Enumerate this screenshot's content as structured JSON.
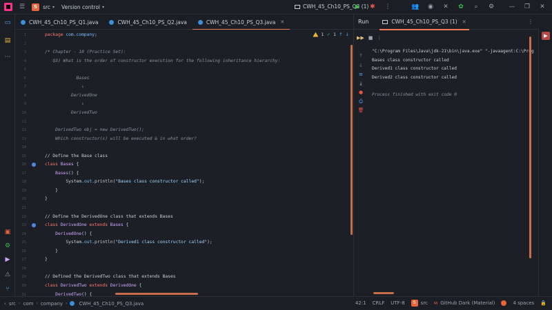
{
  "titlebar": {
    "project_badge": "S",
    "project_name": "src",
    "vcs_label": "Version control",
    "run_config": "CWH_45_Ch10_PS_Q3 (1)",
    "colors": {
      "accent": "#ef7b57",
      "project_badge": "#e8663d",
      "run_green": "#3fb950",
      "debug_red": "#e5534b"
    }
  },
  "editor_tabs": [
    {
      "label": "CWH_45_Ch10_PS_Q1.java"
    },
    {
      "label": "CWH_45_Ch10_PS_Q2.java"
    },
    {
      "label": "CWH_45_Ch10_PS_Q3.java",
      "active": true
    }
  ],
  "inspections": {
    "warnings": "1",
    "weak_warnings": "1"
  },
  "code_lines": [
    {
      "n": "1",
      "segments": [
        {
          "t": "package ",
          "c": "kw"
        },
        {
          "t": "com.company",
          "c": "pk"
        },
        {
          "t": ";",
          "c": ""
        }
      ]
    },
    {
      "n": "2",
      "segments": []
    },
    {
      "n": "3",
      "segments": [
        {
          "t": "/* Chapter - 10 (Practice Set):",
          "c": "cm"
        }
      ]
    },
    {
      "n": "4",
      "segments": [
        {
          "t": "   Q3) What is the order of constructor execution for the following inheritance hierarchy:",
          "c": "cm"
        }
      ]
    },
    {
      "n": "5",
      "segments": []
    },
    {
      "n": "6",
      "segments": [
        {
          "t": "            Bases",
          "c": "cm"
        }
      ]
    },
    {
      "n": "7",
      "segments": [
        {
          "t": "              ↓",
          "c": "cm"
        }
      ]
    },
    {
      "n": "8",
      "segments": [
        {
          "t": "          DerivedOne",
          "c": "cm"
        }
      ]
    },
    {
      "n": "9",
      "segments": [
        {
          "t": "              ↓",
          "c": "cm"
        }
      ]
    },
    {
      "n": "10",
      "segments": [
        {
          "t": "          DerivedTwo",
          "c": "cm"
        }
      ]
    },
    {
      "n": "11",
      "segments": []
    },
    {
      "n": "12",
      "segments": [
        {
          "t": "    DerivedTwo obj = new DerivedTwo();",
          "c": "cm"
        }
      ]
    },
    {
      "n": "13",
      "segments": [
        {
          "t": "    Which constructor(s) will be executed & in what order?",
          "c": "cm"
        }
      ]
    },
    {
      "n": "14",
      "segments": []
    },
    {
      "n": "15",
      "segments": [
        {
          "t": "// Define the Base class",
          "c": ""
        }
      ]
    },
    {
      "n": "16",
      "segments": [
        {
          "t": "class ",
          "c": "kw"
        },
        {
          "t": "Bases",
          "c": "cls"
        },
        {
          "t": " {",
          "c": ""
        }
      ]
    },
    {
      "n": "17",
      "segments": [
        {
          "t": "    ",
          "c": ""
        },
        {
          "t": "Bases",
          "c": "cls"
        },
        {
          "t": "() {",
          "c": ""
        }
      ]
    },
    {
      "n": "18",
      "segments": [
        {
          "t": "        System.",
          "c": ""
        },
        {
          "t": "out",
          "c": "pk"
        },
        {
          "t": ".println(",
          "c": ""
        },
        {
          "t": "\"Bases class constructor called\"",
          "c": "str"
        },
        {
          "t": ");",
          "c": ""
        }
      ]
    },
    {
      "n": "19",
      "segments": [
        {
          "t": "    }",
          "c": ""
        }
      ]
    },
    {
      "n": "20",
      "segments": [
        {
          "t": "}",
          "c": ""
        }
      ]
    },
    {
      "n": "21",
      "segments": []
    },
    {
      "n": "22",
      "segments": [
        {
          "t": "// Define the DerivedOne class that extends Bases",
          "c": ""
        }
      ]
    },
    {
      "n": "23",
      "segments": [
        {
          "t": "class ",
          "c": "kw"
        },
        {
          "t": "DerivedOne ",
          "c": "cls"
        },
        {
          "t": "extends ",
          "c": "kw"
        },
        {
          "t": "Bases",
          "c": "cls"
        },
        {
          "t": " {",
          "c": ""
        }
      ]
    },
    {
      "n": "24",
      "segments": [
        {
          "t": "    ",
          "c": ""
        },
        {
          "t": "DerivedOne",
          "c": "cls"
        },
        {
          "t": "() {",
          "c": ""
        }
      ]
    },
    {
      "n": "25",
      "segments": [
        {
          "t": "        System.",
          "c": ""
        },
        {
          "t": "out",
          "c": "pk"
        },
        {
          "t": ".println(",
          "c": ""
        },
        {
          "t": "\"Derived1 class constructor called\"",
          "c": "str"
        },
        {
          "t": ");",
          "c": ""
        }
      ]
    },
    {
      "n": "26",
      "segments": [
        {
          "t": "    }",
          "c": ""
        }
      ]
    },
    {
      "n": "27",
      "segments": [
        {
          "t": "}",
          "c": ""
        }
      ]
    },
    {
      "n": "28",
      "segments": []
    },
    {
      "n": "29",
      "segments": [
        {
          "t": "// Defined the DerivedTwo class that extends Bases",
          "c": ""
        }
      ]
    },
    {
      "n": "30",
      "segments": [
        {
          "t": "class ",
          "c": "kw"
        },
        {
          "t": "DerivedTwo ",
          "c": "cls"
        },
        {
          "t": "extends ",
          "c": "kw"
        },
        {
          "t": "DerivedOne",
          "c": "cls"
        },
        {
          "t": " {",
          "c": ""
        }
      ]
    },
    {
      "n": "31",
      "segments": [
        {
          "t": "    ",
          "c": ""
        },
        {
          "t": "DerivedTwo",
          "c": "cls"
        },
        {
          "t": "() {",
          "c": ""
        }
      ]
    }
  ],
  "gutter_markers": [
    "16",
    "23"
  ],
  "run_panel": {
    "title": "Run",
    "tab_label": "CWH_45_Ch10_PS_Q3 (1)",
    "console": [
      {
        "text": "\"C:\\Program Files\\Java\\jdk-21\\bin\\java.exe\" \"-javaagent:C:\\Prog",
        "kind": "cmd"
      },
      {
        "text": "Bases class constructor called",
        "kind": "out"
      },
      {
        "text": "Derived1 class constructor called",
        "kind": "out"
      },
      {
        "text": "Derived2 class constructor called",
        "kind": "out"
      },
      {
        "text": "",
        "kind": "out"
      },
      {
        "text": "Process finished with exit code 0",
        "kind": "fin"
      }
    ]
  },
  "statusbar": {
    "breadcrumb": [
      "src",
      "com",
      "company",
      "CWH_45_Ch10_PS_Q3.java"
    ],
    "position": "42:1",
    "line_sep": "CRLF",
    "encoding": "UTF-8",
    "module_badge": "S",
    "module": "src",
    "theme": "GitHub Dark (Material)",
    "indent": "4 spaces"
  }
}
